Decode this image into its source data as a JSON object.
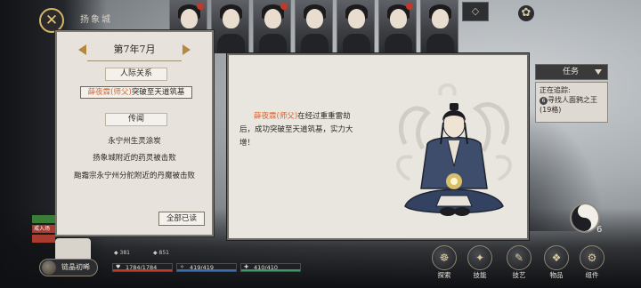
{
  "header": {
    "close_icon": "✕",
    "city_name": "扬象城",
    "top_square": "◇",
    "gear_icon": "✿"
  },
  "event_panel": {
    "date": "第7年7月",
    "relations_title": "人际关系",
    "relation_entry": {
      "name": "薛夜霖(师父)",
      "text": "突破至天道筑基"
    },
    "news_title": "传闻",
    "news_items": [
      "永宁州生灵涂炭",
      "扬象城附近的药灵被击败",
      "颱霜宗永宁州分舵附近的丹魔被击败"
    ],
    "read_all_label": "全部已读"
  },
  "detail_panel": {
    "name": "薛夜霖(师父)",
    "text_part1": "在经过重重雷劫后，成功突破至天道筑基，实力大增！"
  },
  "quest": {
    "header": "任务",
    "tracking_label": "正在追踪:",
    "quest_number": "6",
    "quest_text": "寻找人面鸦之王(19格)"
  },
  "taiji_count": "6",
  "left_tags": [
    "",
    "戒入场",
    "",
    ""
  ],
  "bottom": {
    "skill_button": "链晶初晞",
    "res1": "381",
    "res2": "851",
    "hp": "1784/1784",
    "mp": "419/419",
    "stamina": "410/410"
  },
  "menu": [
    {
      "label": "探索",
      "icon": "compass-icon",
      "glyph": "☸"
    },
    {
      "label": "技能",
      "icon": "skill-icon",
      "glyph": "✦"
    },
    {
      "label": "技艺",
      "icon": "craft-icon",
      "glyph": "✎"
    },
    {
      "label": "物品",
      "icon": "bag-icon",
      "glyph": "❖"
    },
    {
      "label": "组件",
      "icon": "parts-icon",
      "glyph": "⚙"
    }
  ],
  "colors": {
    "highlight": "#d8632c",
    "panel": "#e7e3dc",
    "gold": "#b2893f"
  }
}
